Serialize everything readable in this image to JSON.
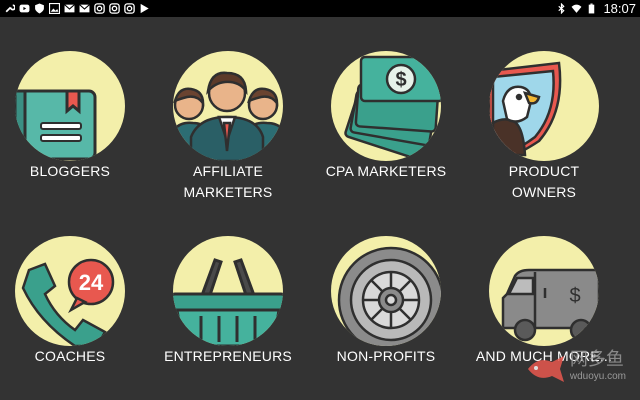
{
  "statusbar": {
    "time": "18:07",
    "left_icons": [
      "wrench-icon",
      "youtube-icon",
      "shield-icon",
      "image-icon",
      "mail-icon",
      "mail-icon",
      "instagram-icon",
      "instagram-icon",
      "instagram-icon",
      "play-store-icon"
    ],
    "right_icons": [
      "bluetooth-icon",
      "wifi-icon",
      "battery-icon"
    ]
  },
  "tiles": [
    {
      "label": "BLOGGERS",
      "icon": "book-icon"
    },
    {
      "label": "AFFILIATE\nMARKETERS",
      "icon": "people-icon"
    },
    {
      "label": "CPA MARKETERS",
      "icon": "money-icon"
    },
    {
      "label": "PRODUCT\nOWNERS",
      "icon": "eagle-shield-icon"
    },
    {
      "label": "COACHES",
      "icon": "phone-icon"
    },
    {
      "label": "ENTREPRENEURS",
      "icon": "basket-icon"
    },
    {
      "label": "NON-PROFITS",
      "icon": "vault-icon"
    },
    {
      "label": "AND MUCH MORE...",
      "icon": "armored-truck-icon"
    }
  ],
  "badge": {
    "coaches_count": "24"
  },
  "watermark": {
    "cn": "网多鱼",
    "url": "wduoyu.com"
  },
  "colors": {
    "background": "#333333",
    "circle": "#f3efaa",
    "teal": "#3aa08c",
    "dark": "#2f2f2f"
  }
}
